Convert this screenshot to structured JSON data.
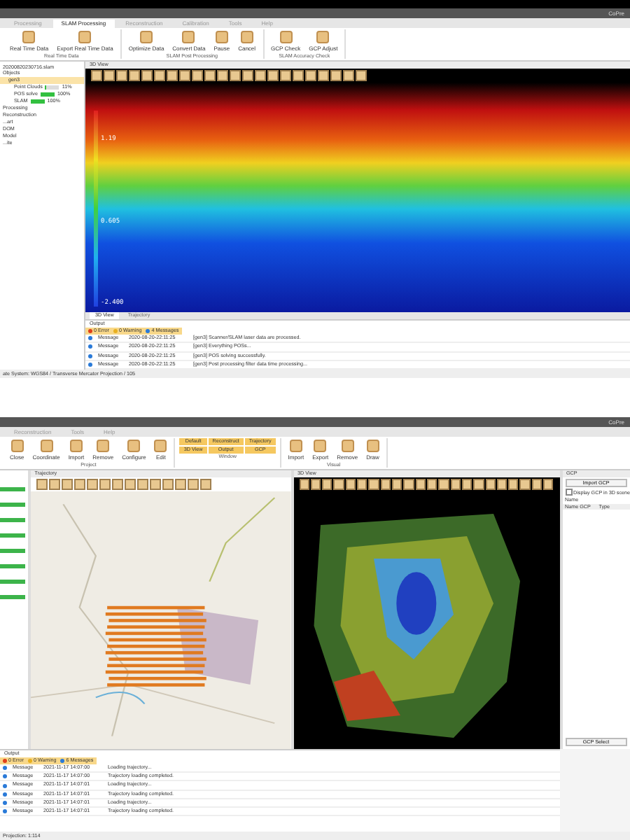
{
  "top_window": {
    "title": "CoPre",
    "menu_tabs": [
      {
        "label": "Processing",
        "selected": false
      },
      {
        "label": "SLAM Processing",
        "selected": true
      },
      {
        "label": "Reconstruction",
        "selected": false
      },
      {
        "label": "Calibration",
        "selected": false
      },
      {
        "label": "Tools",
        "selected": false
      },
      {
        "label": "Help",
        "selected": false
      }
    ],
    "ribbon_groups": [
      {
        "label": "Real Time Data",
        "buttons": [
          "Real Time Data",
          "Export Real Time Data"
        ]
      },
      {
        "label": "SLAM Post Processing",
        "buttons": [
          "Optimize Data",
          "Convert Data",
          "Pause",
          "Cancel"
        ]
      },
      {
        "label": "SLAM Accuracy Check",
        "buttons": [
          "GCP Check",
          "GCP Adjust"
        ]
      }
    ],
    "tree": {
      "file": "20200820230716.slam",
      "items": [
        {
          "label": "Objects",
          "children": [
            {
              "label": "gen3",
              "selected": true,
              "children": [
                {
                  "label": "Point Clouds",
                  "level": 0.11,
                  "reading": "11%"
                },
                {
                  "label": "POS solve",
                  "level": 1,
                  "reading": "100%"
                },
                {
                  "label": "SLAM",
                  "level": 1,
                  "reading": "100%"
                }
              ]
            }
          ]
        },
        {
          "label": "Processing"
        },
        {
          "label": "Reconstruction"
        },
        {
          "label": "...art"
        },
        {
          "label": "DOM"
        },
        {
          "label": "Model"
        },
        {
          "label": "...ite"
        }
      ]
    },
    "view_title": "3D View",
    "scale_labels": [
      "1.19",
      "0.605",
      "-2.400"
    ],
    "view_tabs": [
      {
        "label": "3D View",
        "selected": true
      },
      {
        "label": "Trajectory",
        "selected": false
      }
    ],
    "output": {
      "title": "Output",
      "filters": [
        {
          "label": "0 Error",
          "color": "#e0401a"
        },
        {
          "label": "0 Warning",
          "color": "#e8b020"
        },
        {
          "label": "4 Messages",
          "color": "#2a7ad8"
        }
      ],
      "rows": [
        {
          "type": "Message",
          "time": "2020-08-20-22:11:25",
          "text": "[gen3] Scanner/SLAM laser data are processed."
        },
        {
          "type": "Message",
          "time": "2020-08-20-22:11:25",
          "text": "[gen3] Everything POSs..."
        },
        {
          "type": "Message",
          "time": "2020-08-20-22:11:25",
          "text": "[gen3] POS solving successfully."
        },
        {
          "type": "Message",
          "time": "2020-08-20-22:11:25",
          "text": "[gen3] Post processing filter data time processing..."
        }
      ]
    },
    "status": "ate System: WGS84 / Transverse Mercator Projection / 105"
  },
  "bottom_window": {
    "title": "CoPre",
    "menu_tabs": [
      {
        "label": "Reconstruction",
        "selected": false
      },
      {
        "label": "Tools",
        "selected": false
      },
      {
        "label": "Help",
        "selected": false
      }
    ],
    "ribbon_groups": [
      {
        "label": "Project",
        "buttons": [
          "Close",
          "Coordinate",
          "Import",
          "Remove",
          "Configure",
          "Edit"
        ]
      },
      {
        "label": "Window",
        "buttons": [
          "Default",
          "Reconstruct",
          "Trajectory",
          "3D View",
          "Output",
          "GCP"
        ]
      },
      {
        "label": "Visual",
        "buttons": [
          "Import",
          "Export",
          "Remove",
          "Draw"
        ]
      }
    ],
    "trajectory_title": "Trajectory",
    "view_title": "3D View",
    "gcp": {
      "title": "GCP",
      "import_button": "Import GCP",
      "display_checkbox": {
        "label": "Display GCP in 3D scene",
        "checked": false
      },
      "name_label": "Name",
      "columns": [
        "Name GCP",
        "Type"
      ],
      "footer": "GCP Select"
    },
    "output": {
      "title": "Output",
      "filters": [
        {
          "label": "0 Error",
          "color": "#e0401a"
        },
        {
          "label": "0 Warning",
          "color": "#e8b020"
        },
        {
          "label": "6 Messages",
          "color": "#2a7ad8"
        }
      ],
      "rows": [
        {
          "type": "Message",
          "time": "2021-11-17 14:07:00",
          "text": "Loading trajectory..."
        },
        {
          "type": "Message",
          "time": "2021-11-17 14:07:00",
          "text": "Trajectory loading completed."
        },
        {
          "type": "Message",
          "time": "2021-11-17 14:07:01",
          "text": "Loading trajectory..."
        },
        {
          "type": "Message",
          "time": "2021-11-17 14:07:01",
          "text": "Trajectory loading completed."
        },
        {
          "type": "Message",
          "time": "2021-11-17 14:07:01",
          "text": "Loading trajectory..."
        },
        {
          "type": "Message",
          "time": "2021-11-17 14:07:01",
          "text": "Trajectory loading completed."
        }
      ]
    },
    "status": "Projection: 1:114"
  }
}
